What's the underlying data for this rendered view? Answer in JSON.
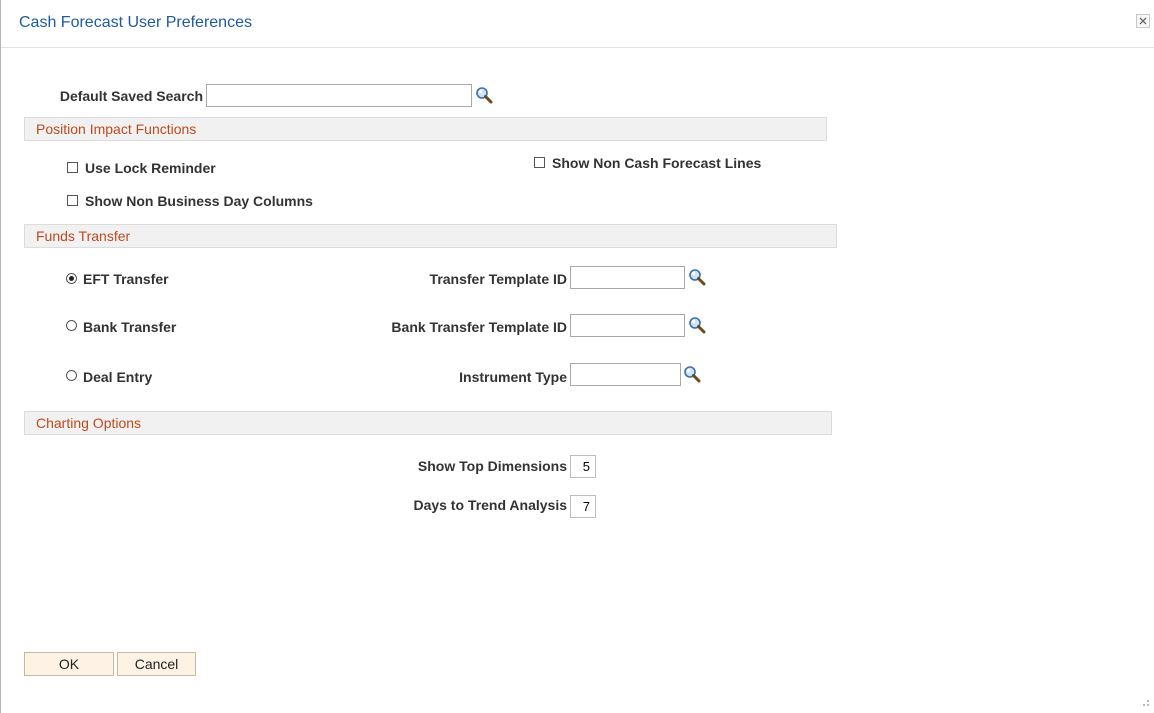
{
  "window": {
    "title": "Cash Forecast User Preferences",
    "close_glyph": "×"
  },
  "default_saved_search": {
    "label": "Default Saved Search",
    "value": ""
  },
  "position_impact": {
    "header": "Position Impact Functions",
    "use_lock_reminder": {
      "label": "Use Lock Reminder",
      "checked": false
    },
    "show_non_cash_forecast_lines": {
      "label": "Show Non Cash Forecast Lines",
      "checked": false
    },
    "show_non_business_day_columns": {
      "label": "Show Non Business Day Columns",
      "checked": false
    }
  },
  "funds_transfer": {
    "header": "Funds Transfer",
    "options": [
      {
        "label": "EFT Transfer",
        "selected": true
      },
      {
        "label": "Bank Transfer",
        "selected": false
      },
      {
        "label": "Deal Entry",
        "selected": false
      }
    ],
    "transfer_template_id": {
      "label": "Transfer Template ID",
      "value": ""
    },
    "bank_transfer_template_id": {
      "label": "Bank Transfer Template ID",
      "value": ""
    },
    "instrument_type": {
      "label": "Instrument Type",
      "value": ""
    }
  },
  "charting": {
    "header": "Charting Options",
    "show_top_dimensions": {
      "label": "Show Top Dimensions",
      "value": "5"
    },
    "days_to_trend_analysis": {
      "label": "Days to Trend Analysis",
      "value": "7"
    }
  },
  "buttons": {
    "ok": "OK",
    "cancel": "Cancel"
  },
  "icons": {
    "lookup": "magnifier-icon",
    "close": "close-icon",
    "resize": "resize-grip-icon"
  },
  "colors": {
    "title": "#1d5a9e",
    "section_header_text": "#bd4a1e",
    "section_header_bg": "#f1f1f1",
    "button_bg": "#fdf2e3"
  }
}
